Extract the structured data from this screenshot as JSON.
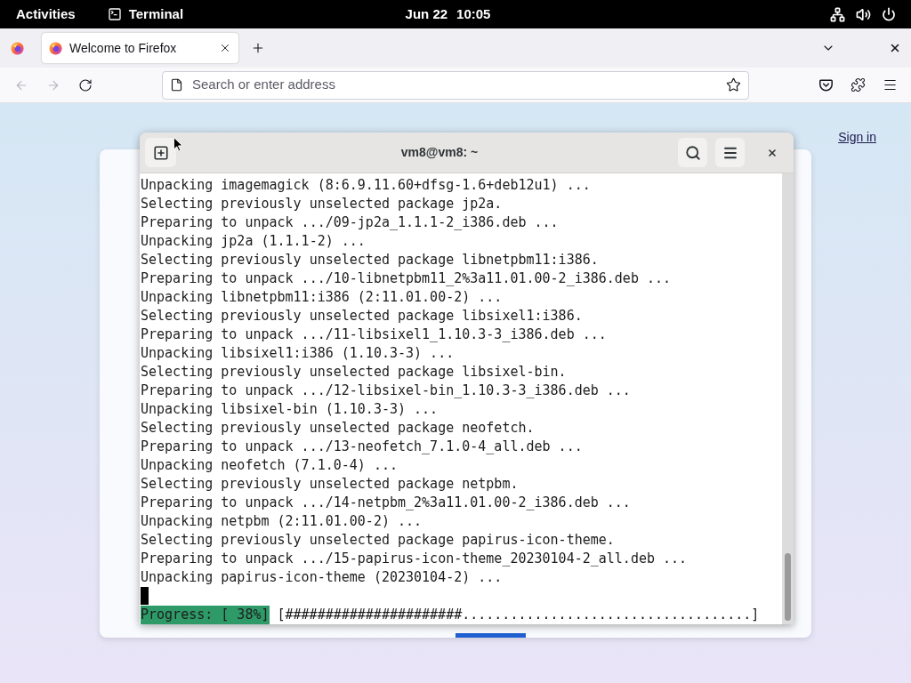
{
  "top_bar": {
    "activities": "Activities",
    "app": "Terminal",
    "date": "Jun 22",
    "time": "10:05"
  },
  "browser": {
    "tabs": [
      {
        "title": "Welcome to Firefox",
        "selected": true
      }
    ],
    "nav_buttons": [
      {
        "kind": "back",
        "disabled": true
      },
      {
        "kind": "forward",
        "disabled": true
      },
      {
        "kind": "reload",
        "disabled": false
      }
    ],
    "address_bar": {
      "placeholder": "Search or enter address"
    }
  },
  "page": {
    "sign_in": "Sign in"
  },
  "terminal": {
    "title": "vm8@vm8: ~",
    "lines": [
      "Unpacking imagemagick (8:6.9.11.60+dfsg-1.6+deb12u1) ...",
      "Selecting previously unselected package jp2a.",
      "Preparing to unpack .../09-jp2a_1.1.1-2_i386.deb ...",
      "Unpacking jp2a (1.1.1-2) ...",
      "Selecting previously unselected package libnetpbm11:i386.",
      "Preparing to unpack .../10-libnetpbm11_2%3a11.01.00-2_i386.deb ...",
      "Unpacking libnetpbm11:i386 (2:11.01.00-2) ...",
      "Selecting previously unselected package libsixel1:i386.",
      "Preparing to unpack .../11-libsixel1_1.10.3-3_i386.deb ...",
      "Unpacking libsixel1:i386 (1.10.3-3) ...",
      "Selecting previously unselected package libsixel-bin.",
      "Preparing to unpack .../12-libsixel-bin_1.10.3-3_i386.deb ...",
      "Unpacking libsixel-bin (1.10.3-3) ...",
      "Selecting previously unselected package neofetch.",
      "Preparing to unpack .../13-neofetch_7.1.0-4_all.deb ...",
      "Unpacking neofetch (7.1.0-4) ...",
      "Selecting previously unselected package netpbm.",
      "Preparing to unpack .../14-netpbm_2%3a11.01.00-2_i386.deb ...",
      "Unpacking netpbm (2:11.01.00-2) ...",
      "Selecting previously unselected package papirus-icon-theme.",
      "Preparing to unpack .../15-papirus-icon-theme_20230104-2_all.deb ...",
      "Unpacking papirus-icon-theme (20230104-2) ..."
    ],
    "cursor": true,
    "progress": {
      "label": "Progress: [ 38%]",
      "bar": "[######################....................................]"
    }
  }
}
